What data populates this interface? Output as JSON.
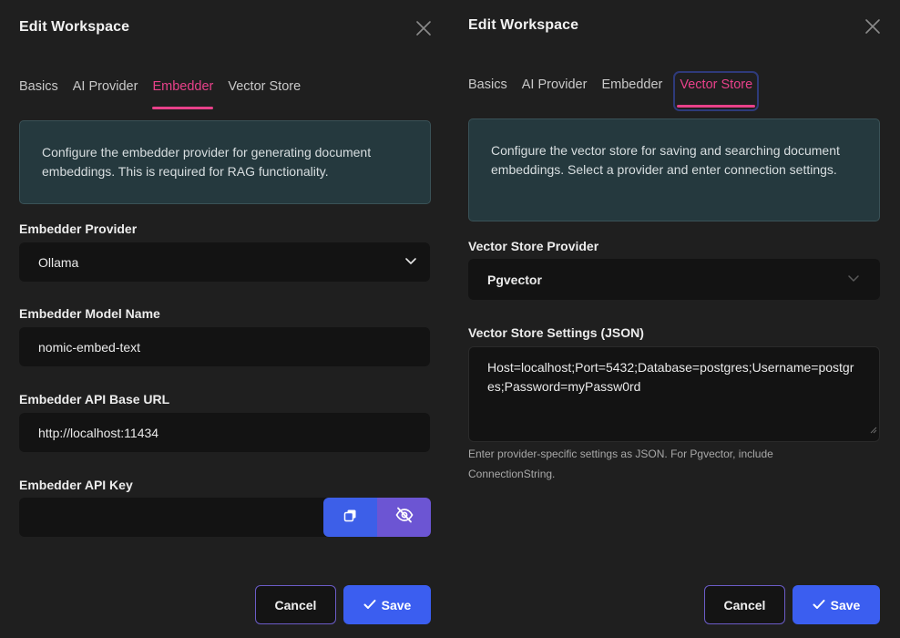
{
  "left": {
    "title": "Edit Workspace",
    "tabs": [
      {
        "label": "Basics"
      },
      {
        "label": "AI Provider"
      },
      {
        "label": "Embedder"
      },
      {
        "label": "Vector Store"
      }
    ],
    "active_tab": "Embedder",
    "info": "Configure the embedder provider for generating document embeddings. This is required for RAG functionality.",
    "fields": {
      "provider_label": "Embedder Provider",
      "provider_value": "Ollama",
      "model_label": "Embedder Model Name",
      "model_value": "nomic-embed-text",
      "base_url_label": "Embedder API Base URL",
      "base_url_value": "http://localhost:11434",
      "api_key_label": "Embedder API Key",
      "api_key_value": ""
    },
    "buttons": {
      "cancel": "Cancel",
      "save": "Save"
    }
  },
  "right": {
    "title": "Edit Workspace",
    "tabs": [
      {
        "label": "Basics"
      },
      {
        "label": "AI Provider"
      },
      {
        "label": "Embedder"
      },
      {
        "label": "Vector Store"
      }
    ],
    "active_tab": "Vector Store",
    "info": "Configure the vector store for saving and searching document embeddings. Select a provider and enter connection settings.",
    "fields": {
      "provider_label": "Vector Store Provider",
      "provider_value": "Pgvector",
      "settings_label": "Vector Store Settings (JSON)",
      "settings_value": "Host=localhost;Port=5432;Database=postgres;Username=postgres;Password=myPassw0rd",
      "help": "Enter provider-specific settings as JSON. For Pgvector, include ConnectionString."
    },
    "buttons": {
      "cancel": "Cancel",
      "save": "Save"
    }
  },
  "icons": {
    "close": "close-icon",
    "chevron": "chevron-down-icon",
    "copy": "copy-icon",
    "eye_off": "eye-off-icon",
    "check": "check-icon"
  },
  "colors": {
    "accent_tab": "#e8418a",
    "primary_button": "#3b5ef0",
    "toggle_button": "#6c55d3",
    "info_background": "#25393e"
  }
}
